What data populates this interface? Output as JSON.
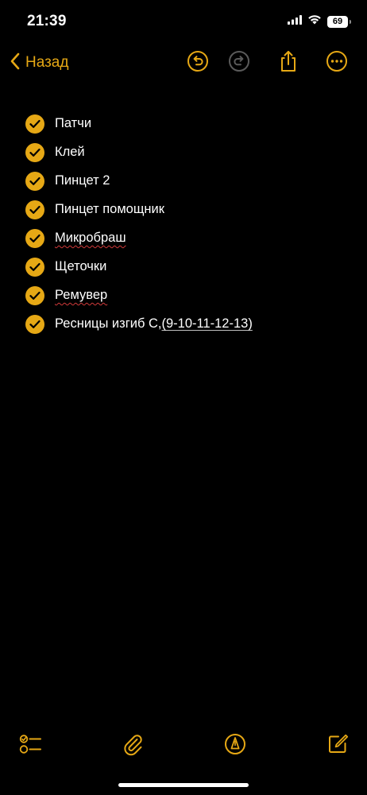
{
  "status_bar": {
    "time": "21:39",
    "battery_level": "69",
    "icons": [
      "signal-icon",
      "wifi-icon",
      "battery-icon"
    ]
  },
  "nav": {
    "back_label": "Назад",
    "icons": [
      "undo-icon",
      "redo-icon",
      "share-icon",
      "more-icon"
    ]
  },
  "checklist": {
    "items": [
      {
        "text": "Патчи",
        "checked": true
      },
      {
        "text": "Клей",
        "checked": true
      },
      {
        "text": "Пинцет 2",
        "checked": true
      },
      {
        "text": "Пинцет помощник",
        "checked": true
      },
      {
        "text": "Микробраш",
        "checked": true
      },
      {
        "text": "Щеточки",
        "checked": true
      },
      {
        "text": "Ремувер",
        "checked": true
      },
      {
        "text": "Ресницы изгиб С,",
        "text_link": "(9-10-11-12-13)",
        "checked": true
      }
    ]
  },
  "toolbar": {
    "icons": [
      "checklist-icon",
      "attachment-icon",
      "markup-icon",
      "compose-icon"
    ]
  },
  "colors": {
    "accent": "#E6A815",
    "background": "#000000",
    "text": "#FFFFFF",
    "disabled": "#5A5A5A"
  }
}
